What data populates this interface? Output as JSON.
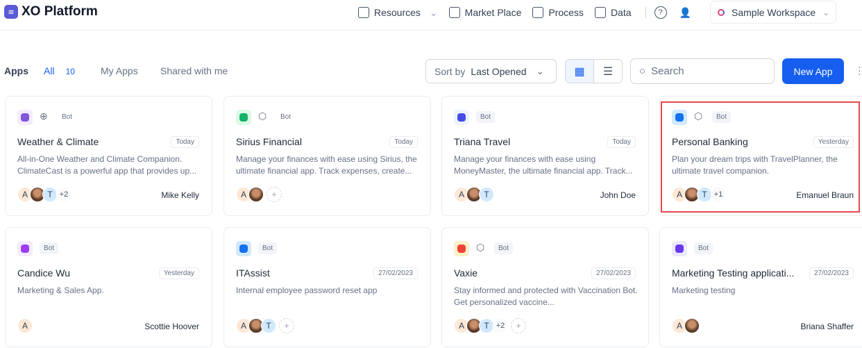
{
  "header": {
    "logo": "XO Platform",
    "nav": [
      {
        "label": "Resources",
        "icon": "document-icon",
        "dropdown": true
      },
      {
        "label": "Market Place",
        "icon": "bag-icon"
      },
      {
        "label": "Process",
        "icon": "external-link-icon"
      },
      {
        "label": "Data",
        "icon": "layout-icon"
      }
    ],
    "help_icon": "?",
    "workspace": "Sample Workspace"
  },
  "toolbar": {
    "title": "Apps",
    "tabs": [
      {
        "label": "All",
        "count": "10",
        "active": true
      },
      {
        "label": "My Apps"
      },
      {
        "label": "Shared with me"
      }
    ],
    "sort_label": "Sort by",
    "sort_value": "Last Opened",
    "search_placeholder": "Search",
    "new_app": "New App"
  },
  "colors": {
    "accent": "#155eef",
    "highlight": "#e5484d"
  },
  "cards": [
    {
      "name": "Weather & Climate",
      "type": "Bot",
      "sub_icon": "globe-icon",
      "date": "Today",
      "desc": "All-in-One Weather and Climate Companion. ClimateCast is a powerful app that provides up...",
      "owner": "Mike Kelly",
      "avatars": [
        "A",
        "photo",
        "T"
      ],
      "extra": "+2",
      "icon_bg": "#f4ebff",
      "icon_fg": "#7f56d9"
    },
    {
      "name": "Sirius Financial",
      "type": "Bot",
      "sub_icon": "cube-icon",
      "date": "Today",
      "desc": "Manage your finances with ease using Sirius, the ultimate financial app. Track expenses, create...",
      "owner": "",
      "avatars": [
        "A",
        "photo"
      ],
      "add": true,
      "icon_bg": "#dcfae6",
      "icon_fg": "#17b26a"
    },
    {
      "name": "Triana Travel",
      "type": "Bot",
      "date": "Today",
      "desc": "Manage your finances with ease using MoneyMaster, the ultimate financial app. Track...",
      "owner": "John Doe",
      "avatars": [
        "A",
        "photo",
        "T"
      ],
      "icon_bg": "#eef4ff",
      "icon_fg": "#444ce7"
    },
    {
      "name": "Personal Banking",
      "type": "Bot",
      "sub_icon": "cube-icon",
      "date": "Yesterday",
      "desc": "Plan your dream trips with TravelPlanner, the ultimate travel companion.",
      "owner": "Emanuel Braun",
      "avatars": [
        "A",
        "photo",
        "T"
      ],
      "extra": "+1",
      "icon_bg": "#d1e9ff",
      "icon_fg": "#1570ef",
      "highlighted": true
    },
    {
      "name": "Candice Wu",
      "type": "Bot",
      "date": "Yesterday",
      "desc": "Marketing & Sales App.",
      "owner": "Scottie Hoover",
      "avatars": [
        "A"
      ],
      "icon_bg": "#f4ebff",
      "icon_fg": "#9e3df5"
    },
    {
      "name": "ITAssist",
      "type": "Bot",
      "date": "27/02/2023",
      "desc": "Internal employee password reset app",
      "owner": "",
      "avatars": [
        "A",
        "photo",
        "T"
      ],
      "add": true,
      "icon_bg": "#d1e9ff",
      "icon_fg": "#1570ef"
    },
    {
      "name": "Vaxie",
      "type": "Bot",
      "sub_icon": "cube-icon",
      "date": "27/02/2023",
      "desc": "Stay informed and protected with Vaccination Bot. Get personalized vaccine...",
      "owner": "",
      "avatars": [
        "A",
        "photo",
        "T"
      ],
      "extra": "+2",
      "add": true,
      "icon_bg": "#fef0c7",
      "icon_fg": "#f04438"
    },
    {
      "name": "Marketing Testing applicati...",
      "type": "Bot",
      "date": "27/02/2023",
      "desc": "Marketing testing",
      "owner": "Briana Shaffer",
      "avatars": [
        "A",
        "photo"
      ],
      "icon_bg": "#ebe9fe",
      "icon_fg": "#6938ef"
    }
  ]
}
